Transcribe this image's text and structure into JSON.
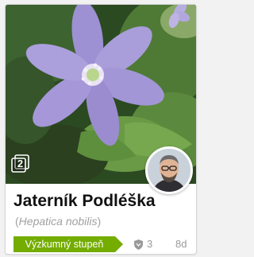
{
  "observation": {
    "photo_count": "2",
    "common_name": "Jaterník Podléška",
    "scientific_open": "(",
    "scientific_name": "Hepatica nobilis",
    "scientific_close": ")",
    "quality_grade": "Výzkumný stupeň",
    "identifications_count": "3",
    "age": "8d"
  },
  "colors": {
    "grade_green": "#74ac00",
    "petal_violet": "#a89ad8"
  },
  "icons": {
    "photos": "stacked-photos-icon",
    "identifications": "shield-icon",
    "avatar": "user-avatar"
  }
}
